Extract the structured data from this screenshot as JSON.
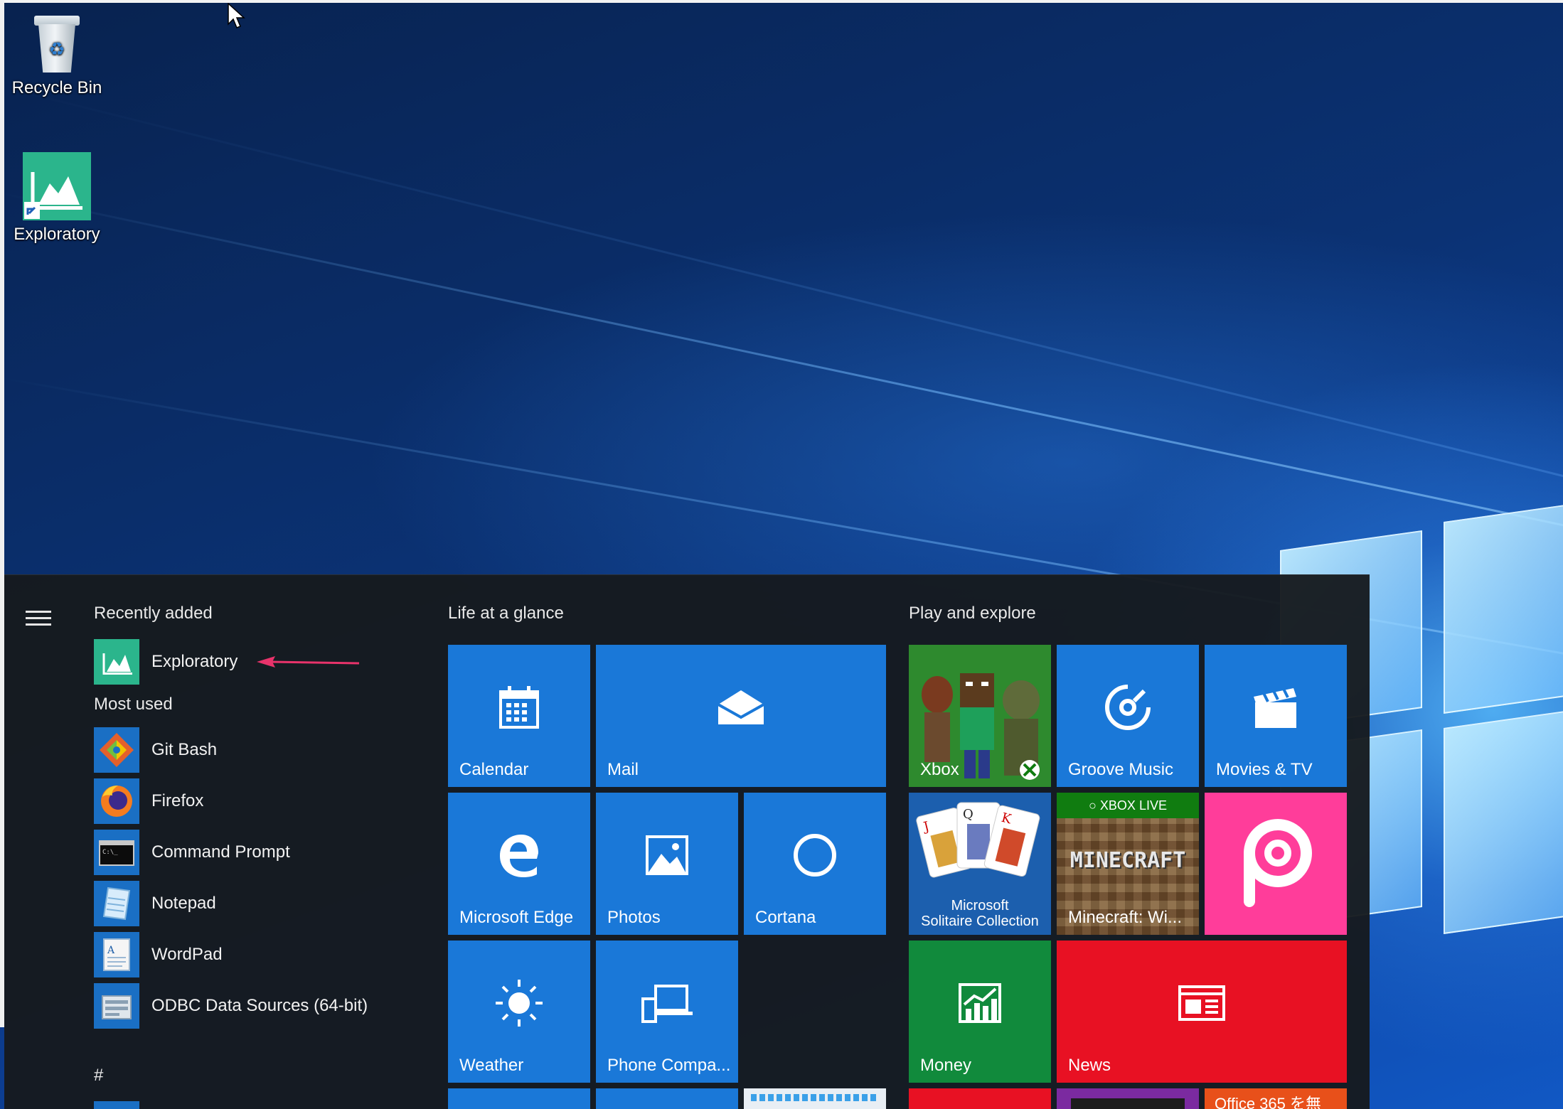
{
  "desktop": {
    "icons": [
      {
        "label": "Recycle Bin"
      },
      {
        "label": "Exploratory"
      }
    ]
  },
  "start_menu": {
    "recently_added": {
      "header": "Recently added",
      "items": [
        {
          "label": "Exploratory",
          "icon": "exploratory-icon"
        }
      ]
    },
    "most_used": {
      "header": "Most used",
      "items": [
        {
          "label": "Git Bash",
          "icon": "git-bash-icon"
        },
        {
          "label": "Firefox",
          "icon": "firefox-icon"
        },
        {
          "label": "Command Prompt",
          "icon": "command-prompt-icon"
        },
        {
          "label": "Notepad",
          "icon": "notepad-icon"
        },
        {
          "label": "WordPad",
          "icon": "wordpad-icon"
        },
        {
          "label": "ODBC Data Sources (64-bit)",
          "icon": "odbc-icon"
        }
      ]
    },
    "letter_header": "#",
    "groups": [
      {
        "title": "Life at a glance"
      },
      {
        "title": "Play and explore"
      }
    ],
    "tiles": {
      "calendar": "Calendar",
      "mail": "Mail",
      "edge": "Microsoft Edge",
      "photos": "Photos",
      "cortana": "Cortana",
      "weather": "Weather",
      "phone": "Phone Compa...",
      "xbox": "Xbox",
      "groove": "Groove Music",
      "movies": "Movies & TV",
      "solitaire_line1": "Microsoft",
      "solitaire_line2": "Solitaire Collection",
      "minecraft_badge": "XBOX LIVE",
      "minecraft_logo": "MINECRAFT",
      "minecraft": "Minecraft: Wi...",
      "money": "Money",
      "news": "News",
      "office": "Office 365 を無"
    }
  },
  "colors": {
    "tile_blue": "#1a78d8",
    "xbox_green": "#107c10",
    "money_green": "#118a3c",
    "news_red": "#e81123",
    "picsart_pink": "#ff3d9a",
    "start_bg": "#16191d",
    "arrow": "#e8336b"
  }
}
